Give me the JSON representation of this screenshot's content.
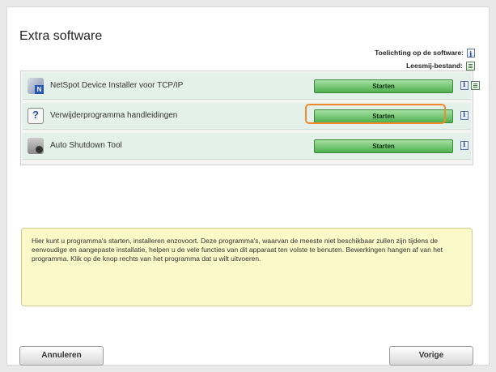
{
  "title": "Extra software",
  "legend": {
    "explanation_label": "Toelichting op de software:",
    "readme_label": "Leesmij-bestand:"
  },
  "items": [
    {
      "label": "NetSpot Device Installer voor TCP/IP",
      "icon": "netspot-icon",
      "button": "Starten",
      "has_info": true,
      "has_readme": true
    },
    {
      "label": "Verwijderprogramma handleidingen",
      "icon": "uninstaller-icon",
      "button": "Starten",
      "has_info": true,
      "has_readme": false
    },
    {
      "label": "Auto Shutdown Tool",
      "icon": "shutdown-tool-icon",
      "button": "Starten",
      "has_info": true,
      "has_readme": false
    }
  ],
  "description": "Hier kunt u programma's starten, installeren enzovoort. Deze programma's, waarvan de meeste niet beschikbaar zullen zijn tijdens de eenvoudige en aangepaste installatie, helpen u de vele functies van dit apparaat ten volste te benuten. Bewerkingen hangen af van het programma. Klik op de knop rechts van het programma dat u wilt uitvoeren.",
  "buttons": {
    "cancel": "Annuleren",
    "previous": "Vorige"
  },
  "colors": {
    "highlight": "#f08a2a",
    "start_button": "#4fb04e",
    "description_bg": "#fbf9c8"
  }
}
